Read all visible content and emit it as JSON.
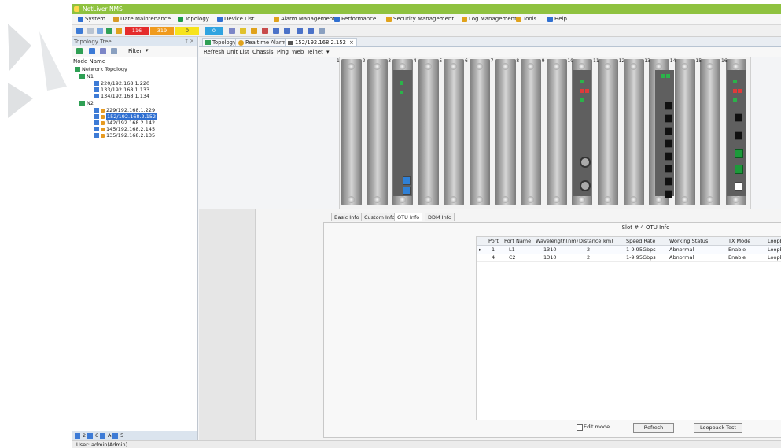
{
  "app": {
    "title": "NetLiver NMS"
  },
  "menu": [
    {
      "label": "System",
      "icon": "system-icon",
      "color": "#2f6fd1"
    },
    {
      "label": "Date Maintenance",
      "icon": "maintenance-icon",
      "color": "#d89a25"
    },
    {
      "label": "Topology",
      "icon": "topology-icon",
      "color": "#1e9c44"
    },
    {
      "label": "Device List",
      "icon": "device-list-icon",
      "color": "#2f6fd1"
    },
    {
      "label": "Alarm Management",
      "icon": "alarm-icon",
      "color": "#e0a21b"
    },
    {
      "label": "Performance",
      "icon": "performance-icon",
      "color": "#2f6fd1"
    },
    {
      "label": "Security Management",
      "icon": "security-icon",
      "color": "#e0a21b"
    },
    {
      "label": "Log Management",
      "icon": "log-icon",
      "color": "#e0a21b"
    },
    {
      "label": "Tools",
      "icon": "tools-icon",
      "color": "#e0a21b"
    },
    {
      "label": "Help",
      "icon": "help-icon",
      "color": "#2f6fd1"
    }
  ],
  "toolbar": {
    "alarm_counts": [
      {
        "value": "116",
        "color": "#e52b2b"
      },
      {
        "value": "319",
        "color": "#f09a1c"
      },
      {
        "value": "0",
        "color": "#f7e31c"
      },
      {
        "value": "0",
        "color": "#2fa3e0"
      }
    ]
  },
  "left_panel": {
    "title": "Topology Tree",
    "controls": "† ×",
    "filter_label": "Filter",
    "tree_header": "Node Name",
    "root": "Network Topology",
    "n1": {
      "label": "N1",
      "nodes": [
        "220/192.168.1.220",
        "133/192.168.1.133",
        "134/192.168.1.134"
      ]
    },
    "n2": {
      "label": "N2",
      "nodes": [
        "229/192.168.1.229",
        "152/192.168.2.152",
        "142/192.168.2.142",
        "145/192.168.2.145",
        "135/192.168.2.135"
      ]
    },
    "bottom": [
      "2",
      "6",
      "AC",
      "5"
    ]
  },
  "tabs": {
    "topology": "Topology",
    "realtime_alarm": "Realtime Alarm",
    "device": "152/192.168.2.152"
  },
  "subtoolbar": [
    "Refresh",
    "Unit List",
    "Chassis",
    "Ping",
    "Web",
    "Telnet"
  ],
  "chassis": {
    "slot_numbers": [
      "1",
      "2",
      "3",
      "4",
      "5",
      "6",
      "7",
      "8",
      "9",
      "10",
      "11",
      "12",
      "13",
      "14",
      "15",
      "16"
    ]
  },
  "detail": {
    "inner_tabs": [
      "Basic Info",
      "Custom Info",
      "OTU Info",
      "DDM Info"
    ],
    "otu": {
      "title": "Slot # 4 OTU Info",
      "columns": [
        "Port",
        "Port Name",
        "Wavelength(nm)",
        "Distance(km)",
        "Speed Rate",
        "Working Status",
        "TX Mode",
        "Loopback"
      ],
      "rows": [
        [
          "1",
          "L1",
          "1310",
          "2",
          "1-9.95Gbps",
          "Abnormal",
          "Enable",
          "Loopback"
        ],
        [
          "4",
          "C2",
          "1310",
          "2",
          "1-9.95Gbps",
          "Abnormal",
          "Enable",
          "Loopback"
        ]
      ],
      "edit_mode": "Edit mode",
      "refresh": "Refresh",
      "loopback_test": "Loopback Test"
    }
  },
  "status": {
    "user": "User: admin(Admin)"
  }
}
